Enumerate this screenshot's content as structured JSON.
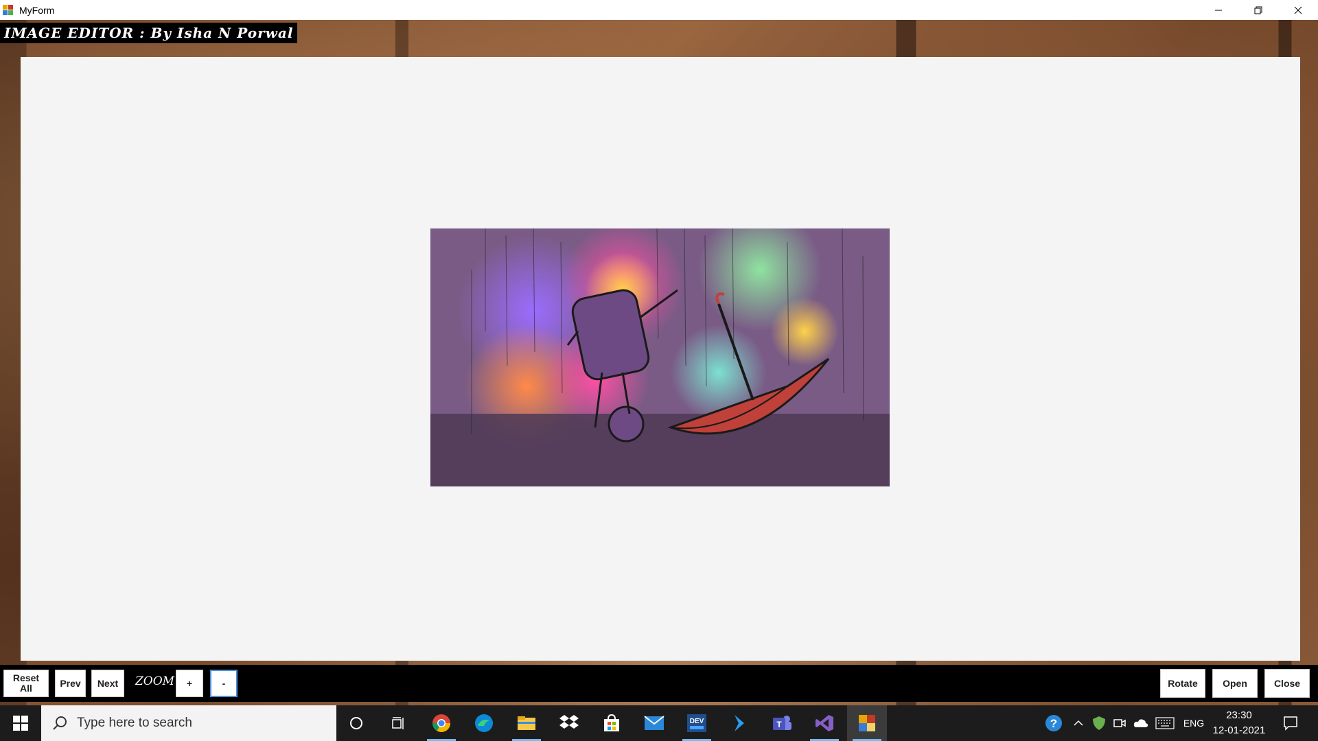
{
  "window": {
    "title": "MyForm",
    "controls": [
      "minimize",
      "restore",
      "close"
    ]
  },
  "form": {
    "heading": "IMAGE EDITOR : By Isha N Porwal"
  },
  "toolbar": {
    "reset_label": "Reset All",
    "prev_label": "Prev",
    "next_label": "Next",
    "zoom_label": "ZOOM",
    "zoom_in_label": "+",
    "zoom_out_label": "-",
    "rotate_label": "Rotate",
    "open_label": "Open",
    "close_label": "Close"
  },
  "taskbar": {
    "search_placeholder": "Type here to search",
    "pinned_apps": [
      "cortana-icon",
      "task-view-icon",
      "chrome-icon",
      "edge-icon",
      "file-explorer-icon",
      "dropbox-icon",
      "store-icon",
      "mail-icon",
      "dev-icon",
      "azure-data-studio-icon",
      "teams-icon",
      "visual-studio-icon",
      "myform-app-icon"
    ],
    "language": "ENG",
    "time": "23:30",
    "date": "12-01-2021"
  },
  "colors": {
    "accent": "#76b9ed",
    "canvas": "#f4f4f4",
    "taskbar": "#1c1c1c"
  }
}
